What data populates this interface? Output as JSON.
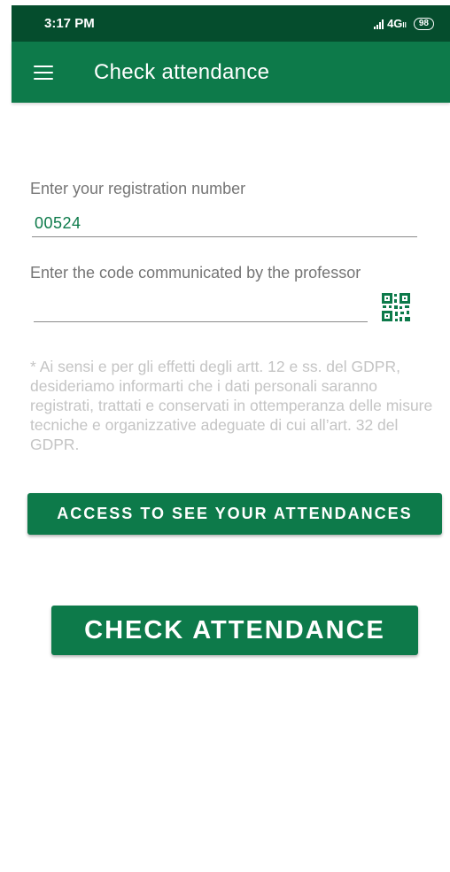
{
  "status_bar": {
    "time": "3:17 PM",
    "network": "4G",
    "network_suffix": "ll",
    "battery": "98"
  },
  "app_bar": {
    "title": "Check attendance",
    "menu_icon": "hamburger-menu-icon"
  },
  "form": {
    "registration_label": "Enter your registration number",
    "registration_value": "00524",
    "code_label": "Enter the code communicated by the professor",
    "code_value": "",
    "qr_icon": "qr-code-icon"
  },
  "privacy_text": "* Ai sensi e per gli effetti degli artt. 12 e ss. del GDPR, desideriamo informarti che i dati personali saranno registrati, trattati e conservati in ottemperanza delle misure tecniche e organizzative adeguate di cui all’art. 32 del GDPR.",
  "buttons": {
    "access_label": "ACCESS TO SEE YOUR ATTENDANCES",
    "check_label": "CHECK ATTENDANCE"
  },
  "colors": {
    "status_bar": "#054d2d",
    "primary": "#0d7a4a",
    "hint_text": "#c4c4c4"
  }
}
